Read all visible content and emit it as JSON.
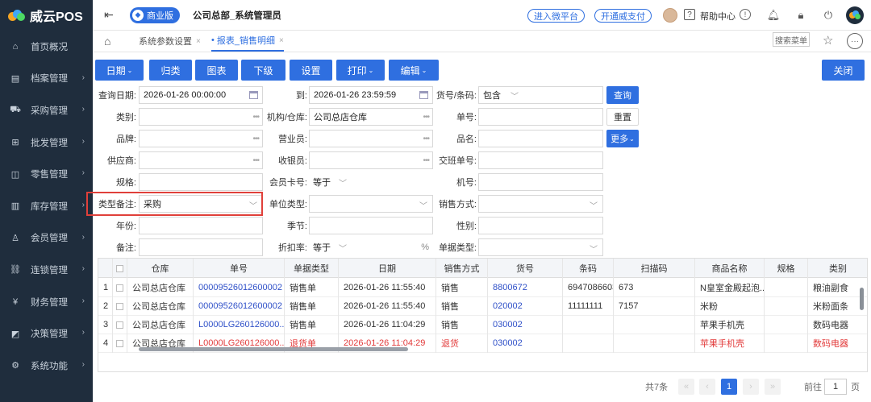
{
  "app": {
    "name": "威云POS"
  },
  "sidebar": {
    "items": [
      {
        "label": "首页概况",
        "icon": "home-icon"
      },
      {
        "label": "档案管理",
        "icon": "archive-icon"
      },
      {
        "label": "采购管理",
        "icon": "cart-icon"
      },
      {
        "label": "批发管理",
        "icon": "wholesale-icon"
      },
      {
        "label": "零售管理",
        "icon": "retail-icon"
      },
      {
        "label": "库存管理",
        "icon": "inventory-icon"
      },
      {
        "label": "会员管理",
        "icon": "member-icon"
      },
      {
        "label": "连锁管理",
        "icon": "chain-icon"
      },
      {
        "label": "财务管理",
        "icon": "finance-icon"
      },
      {
        "label": "决策管理",
        "icon": "decision-icon"
      },
      {
        "label": "系统功能",
        "icon": "settings-icon"
      }
    ]
  },
  "header": {
    "edition": "商业版",
    "company": "公司总部_系统管理员",
    "link_platform": "进入微平台",
    "link_pay": "开通威支付",
    "help": "帮助中心"
  },
  "tabs": [
    {
      "label": "系统参数设置"
    },
    {
      "label": "报表_销售明细"
    }
  ],
  "search_menu": "搜索菜单",
  "toolbar": {
    "buttons": [
      "日期",
      "归类",
      "图表",
      "下级",
      "设置",
      "打印",
      "编辑"
    ],
    "close": "关闭"
  },
  "form": {
    "labels": {
      "query_date": "查询日期:",
      "to": "到:",
      "goods_code": "货号/条码:",
      "category": "类别:",
      "org": "机构/仓库:",
      "order_no": "单号:",
      "brand": "品牌:",
      "salesman": "营业员:",
      "product_name": "品名:",
      "supplier": "供应商:",
      "cashier": "收银员:",
      "shift_no": "交班单号:",
      "spec": "规格:",
      "member_card": "会员卡号:",
      "machine_no": "机号:",
      "type_note": "类型备注:",
      "unit_type": "单位类型:",
      "sale_method": "销售方式:",
      "year": "年份:",
      "season": "季节:",
      "gender": "性别:",
      "remark": "备注:",
      "discount": "折扣率:",
      "doc_type": "单据类型:"
    },
    "values": {
      "date_from": "2026-01-26 00:00:00",
      "date_to": "2026-01-26 23:59:59",
      "goods_mode": "包含",
      "org": "公司总店仓库",
      "member_op": "等于",
      "type_note": "采购",
      "discount_op": "等于",
      "pct": "%"
    },
    "buttons": {
      "query": "查询",
      "reset": "重置",
      "more": "更多"
    }
  },
  "table": {
    "columns": [
      "仓库",
      "单号",
      "单据类型",
      "日期",
      "销售方式",
      "货号",
      "条码",
      "扫描码",
      "商品名称",
      "规格",
      "类别"
    ],
    "rows": [
      {
        "n": "1",
        "cells": [
          "公司总店仓库",
          "00009526012600002",
          "销售单",
          "2026-01-26 11:55:40",
          "销售",
          "8800672",
          "6947086603647",
          "673",
          "N皇室金殿起泡...",
          "",
          "粮油副食"
        ]
      },
      {
        "n": "2",
        "cells": [
          "公司总店仓库",
          "00009526012600002",
          "销售单",
          "2026-01-26 11:55:40",
          "销售",
          "020002",
          "11111111",
          "7157",
          "米粉",
          "",
          "米粉面条"
        ]
      },
      {
        "n": "3",
        "cells": [
          "公司总店仓库",
          "L0000LG260126000...",
          "销售单",
          "2026-01-26 11:04:29",
          "销售",
          "030002",
          "",
          "",
          "苹果手机壳",
          "",
          "数码电器"
        ]
      },
      {
        "n": "4",
        "cells": [
          "公司总店仓库",
          "L0000LG260126000...",
          "退货单",
          "2026-01-26 11:04:29",
          "退货",
          "030002",
          "",
          "",
          "苹果手机壳",
          "",
          "数码电器"
        ]
      }
    ]
  },
  "pager": {
    "total": "共7条",
    "page": "1",
    "goto_label": "前往",
    "goto_value": "1",
    "page_unit": "页"
  }
}
